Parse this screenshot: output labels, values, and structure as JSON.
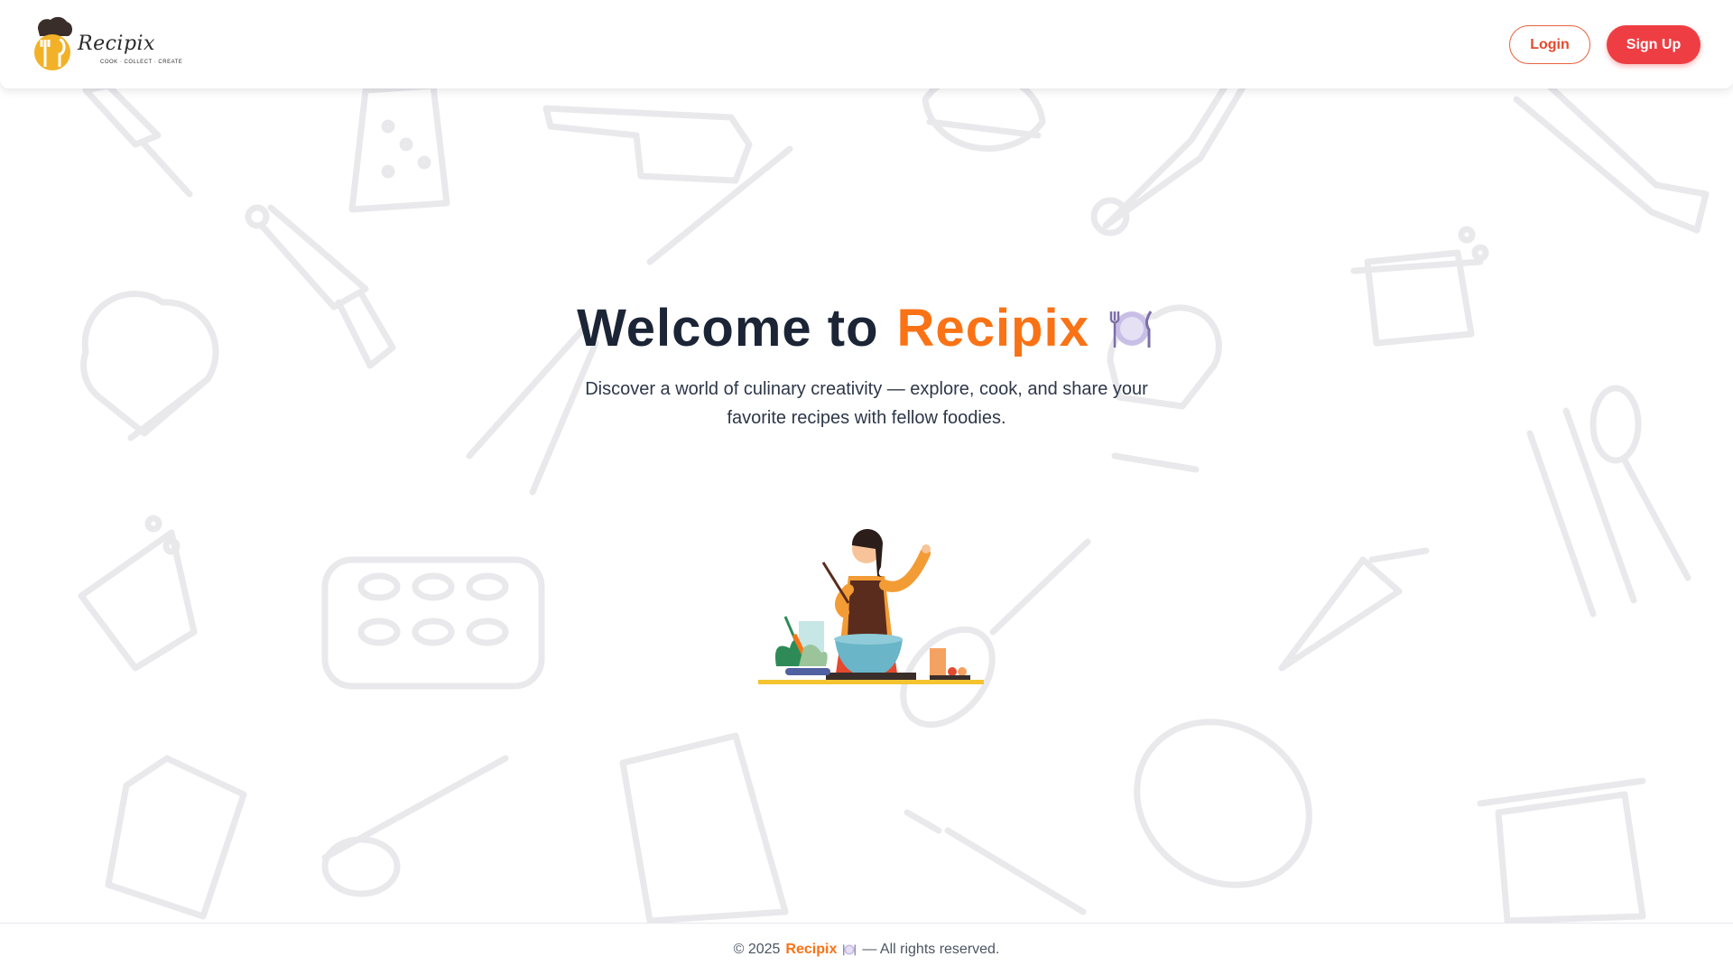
{
  "header": {
    "logo": {
      "name": "Recipix",
      "tagline": "COOK · COLLECT · CREATE"
    },
    "login_label": "Login",
    "signup_label": "Sign Up"
  },
  "hero": {
    "title_prefix": "Welcome to",
    "title_brand": "Recipix",
    "title_icon": "plate-with-cutlery-icon",
    "subtitle": "Discover a world of culinary creativity — explore, cook, and share your favorite recipes with fellow foodies.",
    "illustration": "woman-cooking-illustration"
  },
  "footer": {
    "copyright": "© 2025",
    "brand": "Recipix",
    "brand_icon": "plate-with-cutlery-icon",
    "rights": "— All rights reserved."
  },
  "colors": {
    "brand_orange": "#f97316",
    "signup_red": "#ee3e44",
    "login_text": "#e4492e",
    "title_dark": "#1c2536",
    "doodle_gray": "#e9e9ec"
  }
}
